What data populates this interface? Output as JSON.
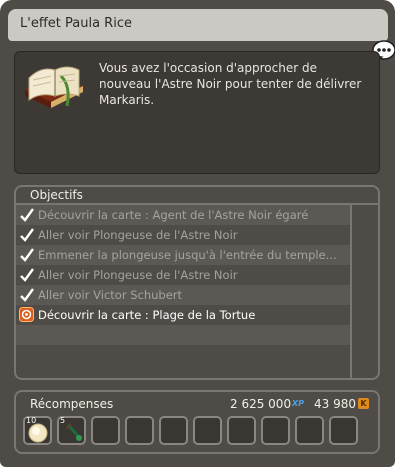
{
  "window": {
    "title": "L'effet Paula Rice"
  },
  "description": {
    "text": "Vous avez l'occasion d'approcher de nouveau l'Astre Noir pour tenter de délivrer Markaris."
  },
  "objectives": {
    "header": "Objectifs",
    "items": [
      {
        "label": "Découvrir la carte : Agent de l'Astre Noir égaré",
        "status": "done"
      },
      {
        "label": "Aller voir Plongeuse de l'Astre Noir",
        "status": "done"
      },
      {
        "label": "Emmener la plongeuse jusqu'à l'entrée du temple...",
        "status": "done"
      },
      {
        "label": "Aller voir Plongeuse de l'Astre Noir",
        "status": "done"
      },
      {
        "label": "Aller voir Victor Schubert",
        "status": "done"
      },
      {
        "label": "Découvrir la carte : Plage de la Tortue",
        "status": "active"
      }
    ]
  },
  "rewards": {
    "label": "Récompenses",
    "xp": "2 625 000",
    "xp_icon": "XP",
    "kamas": "43 980",
    "kamas_icon": "K",
    "items": [
      {
        "qty": "10",
        "icon": "orb-icon"
      },
      {
        "qty": "5",
        "icon": "potion-icon"
      }
    ]
  }
}
